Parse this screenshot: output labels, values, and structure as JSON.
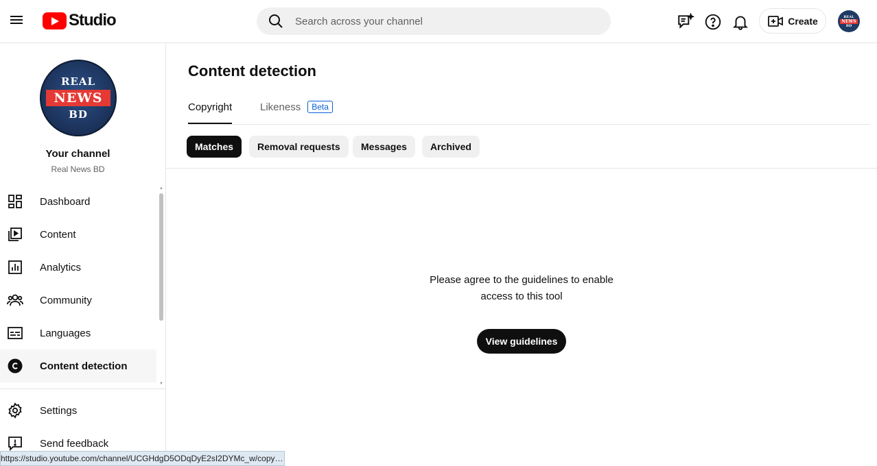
{
  "header": {
    "logo_text": "Studio",
    "search_placeholder": "Search across your channel",
    "create_label": "Create",
    "avatar_lines": [
      "REAL",
      "NEWS",
      "BD"
    ]
  },
  "sidebar": {
    "avatar_lines": [
      "REAL",
      "NEWS",
      "BD"
    ],
    "channel_title": "Your channel",
    "channel_name": "Real News BD",
    "items": [
      {
        "label": "Dashboard",
        "icon": "dashboard-icon"
      },
      {
        "label": "Content",
        "icon": "content-icon"
      },
      {
        "label": "Analytics",
        "icon": "analytics-icon"
      },
      {
        "label": "Community",
        "icon": "community-icon"
      },
      {
        "label": "Languages",
        "icon": "languages-icon"
      },
      {
        "label": "Content detection",
        "icon": "content-detection-icon",
        "active": true
      }
    ],
    "bottom_items": [
      {
        "label": "Settings",
        "icon": "gear-icon"
      },
      {
        "label": "Send feedback",
        "icon": "feedback-icon"
      }
    ]
  },
  "main": {
    "title": "Content detection",
    "tabs": [
      {
        "label": "Copyright",
        "active": true
      },
      {
        "label": "Likeness",
        "badge": "Beta"
      }
    ],
    "chips": [
      {
        "label": "Matches",
        "active": true
      },
      {
        "label": "Removal requests"
      },
      {
        "label": "Messages"
      },
      {
        "label": "Archived"
      }
    ],
    "empty_message": "Please agree to the guidelines to enable access to this tool",
    "button_label": "View guidelines"
  },
  "status_bar": {
    "url": "https://studio.youtube.com/channel/UCGHdgD5ODqDyE2sI2DYMc_w/copyri..."
  },
  "colors": {
    "brand_red": "#ff0000",
    "link_blue": "#065fd4",
    "text": "#0f0f0f"
  }
}
